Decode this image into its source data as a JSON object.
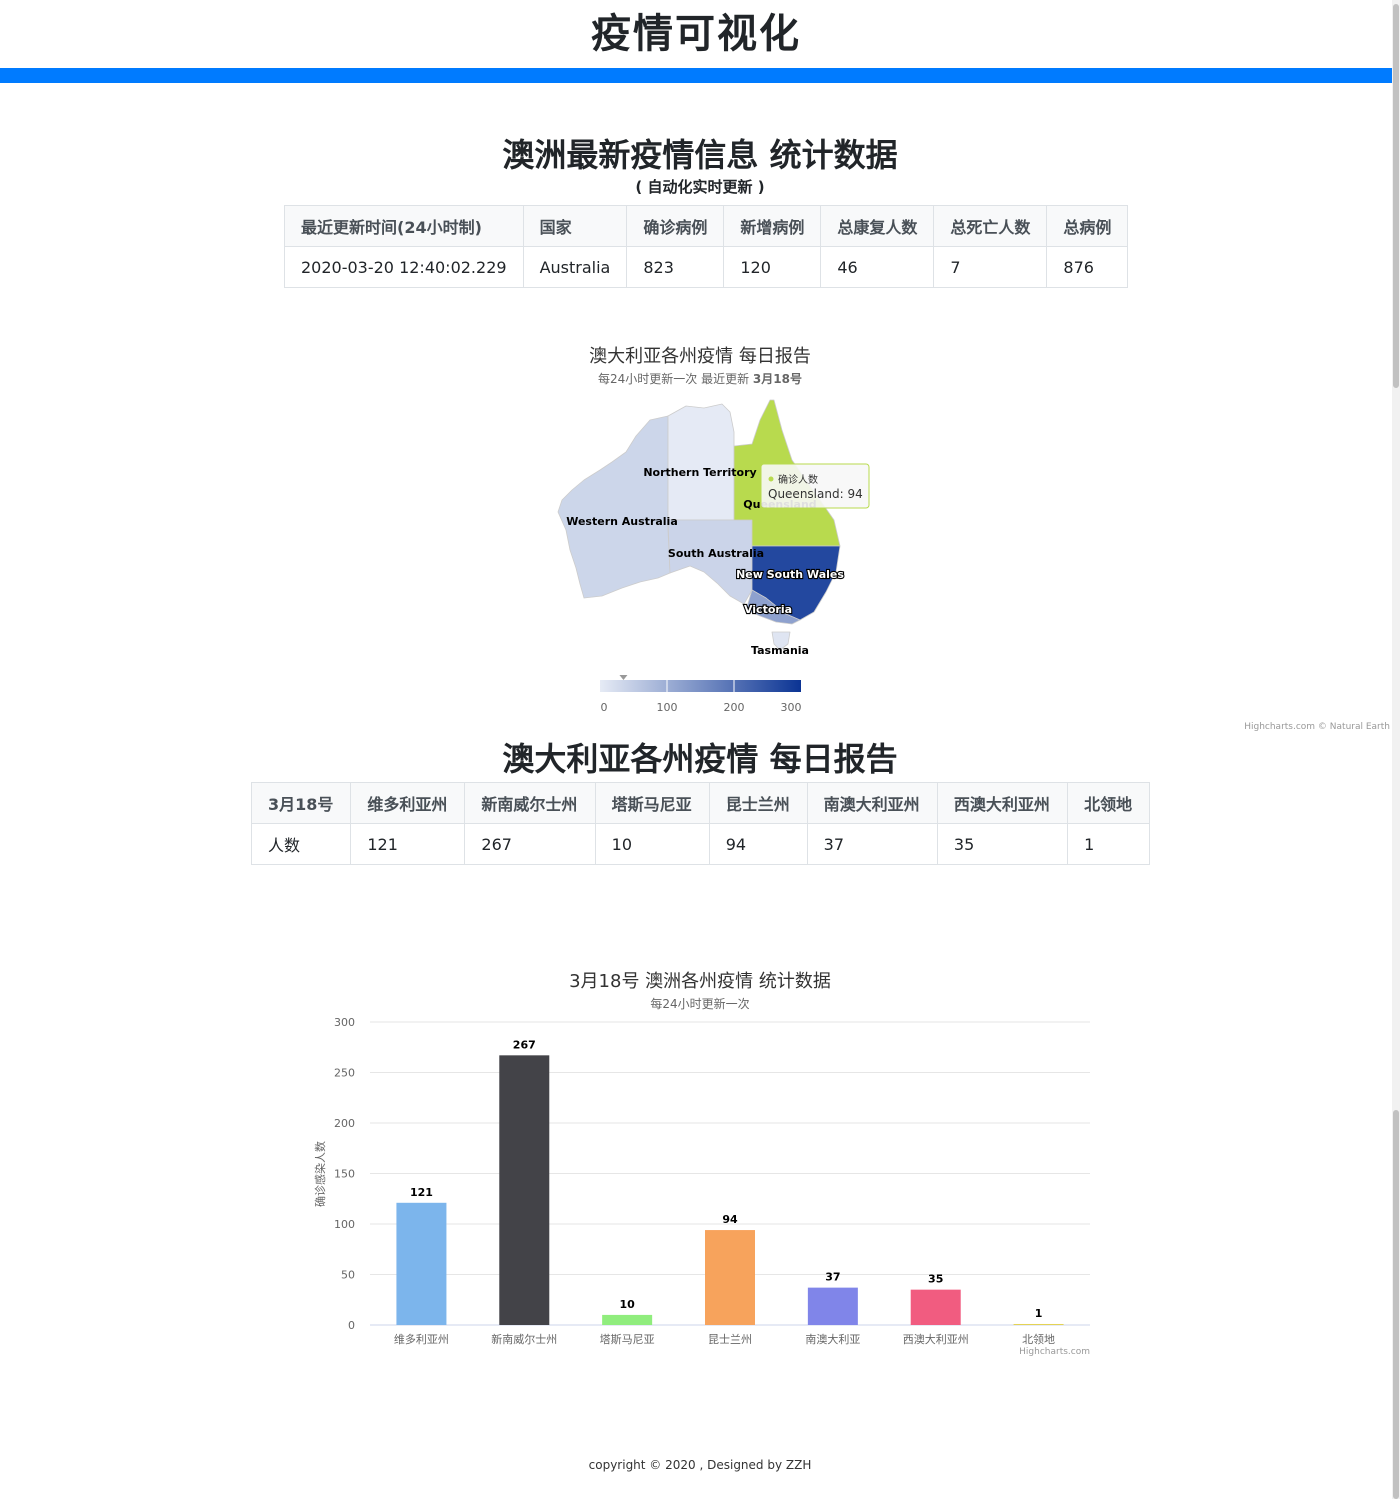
{
  "header": {
    "title": "疫情可视化"
  },
  "summary": {
    "title": "澳洲最新疫情信息 统计数据",
    "subtitle": "( 自动化实时更新 )",
    "columns": [
      "最近更新时间(24小时制)",
      "国家",
      "确诊病例",
      "新增病例",
      "总康复人数",
      "总死亡人数",
      "总病例"
    ],
    "row": [
      "2020-03-20 12:40:02.229",
      "Australia",
      "823",
      "120",
      "46",
      "7",
      "876"
    ]
  },
  "map": {
    "title": "澳大利亚各州疫情 每日报告",
    "subtitle_prefix": "每24小时更新一次 最近更新 ",
    "subtitle_date": "3月18号",
    "colors": {
      "low": "#e6ebf5",
      "high": "#0b3494",
      "queensland_hover": "#b8da4e"
    },
    "states": [
      {
        "name": "Western Australia",
        "value": 35
      },
      {
        "name": "Northern Territory",
        "value": 1
      },
      {
        "name": "South Australia",
        "value": 37
      },
      {
        "name": "Queensland",
        "value": 94
      },
      {
        "name": "New South Wales",
        "value": 267
      },
      {
        "name": "Victoria",
        "value": 121
      },
      {
        "name": "Tasmania",
        "value": 10
      }
    ],
    "tooltip": {
      "series": "确诊人数",
      "text": "Queensland: 94"
    },
    "legend": {
      "ticks": [
        "0",
        "100",
        "200",
        "300"
      ],
      "min": 0,
      "max": 300,
      "marker_value": 35
    },
    "credits": "Highcharts.com © Natural Earth"
  },
  "states_table": {
    "title": "澳大利亚各州疫情 每日报告",
    "columns": [
      "3月18号",
      "维多利亚州",
      "新南威尔士州",
      "塔斯马尼亚",
      "昆士兰州",
      "南澳大利亚州",
      "西澳大利亚州",
      "北领地"
    ],
    "row": [
      "人数",
      "121",
      "267",
      "10",
      "94",
      "37",
      "35",
      "1"
    ]
  },
  "chart_data": {
    "type": "bar",
    "title": "3月18号 澳洲各州疫情 统计数据",
    "subtitle": "每24小时更新一次",
    "ylabel": "确诊感染人数",
    "xlabel": "",
    "ylim": [
      0,
      300
    ],
    "yticks": [
      0,
      50,
      100,
      150,
      200,
      250,
      300
    ],
    "categories": [
      "维多利亚州",
      "新南威尔士州",
      "塔斯马尼亚",
      "昆士兰州",
      "南澳大利亚",
      "西澳大利亚州",
      "北领地"
    ],
    "values": [
      121,
      267,
      10,
      94,
      37,
      35,
      1
    ],
    "colors": [
      "#7cb5ec",
      "#434348",
      "#90ed7d",
      "#f7a35c",
      "#8085e9",
      "#f15c80",
      "#e4d354"
    ],
    "grid": true,
    "legend": "none",
    "credits": "Highcharts.com"
  },
  "footer": {
    "text": "copyright © 2020 , Designed by ZZH"
  }
}
